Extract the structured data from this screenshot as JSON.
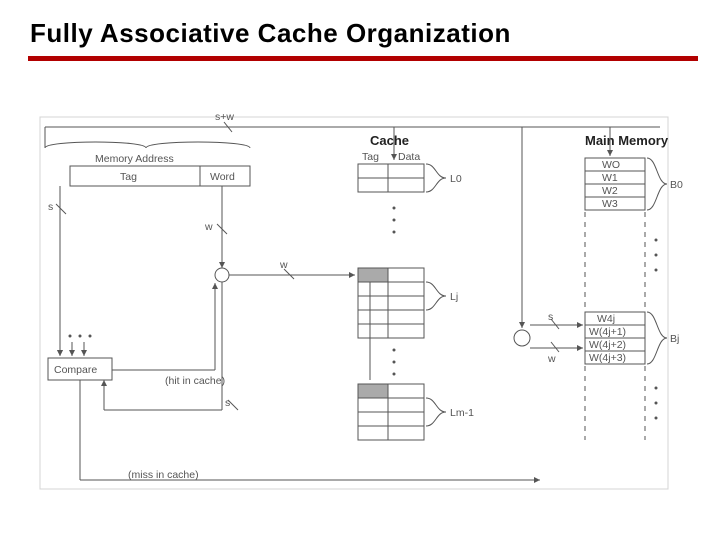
{
  "title": "Fully Associative Cache Organization",
  "labels": {
    "s_plus_w": "s+w",
    "mem_addr": "Memory Address",
    "tag": "Tag",
    "word": "Word",
    "s": "s",
    "w": "w",
    "compare": "Compare",
    "hit": "(hit in cache)",
    "miss": "(miss in cache)",
    "cache": "Cache",
    "cache_tag": "Tag",
    "cache_data": "Data",
    "L0": "L0",
    "Lj": "Lj",
    "Lm1": "Lm-1",
    "main_memory": "Main Memory",
    "WO": "WO",
    "W1": "W1",
    "W2": "W2",
    "W3": "W3",
    "B0": "B0",
    "W4j": "W4j",
    "W4j1": "W(4j+1)",
    "W4j2": "W(4j+2)",
    "W4j3": "W(4j+3)",
    "Bj": "Bj"
  },
  "chart_data": {
    "type": "table",
    "title": "Fully Associative Cache Organization",
    "components": [
      {
        "name": "Memory Address",
        "fields": [
          "Tag (s bits)",
          "Word (w bits)"
        ],
        "total_width": "s+w"
      },
      {
        "name": "Cache",
        "columns": [
          "Tag",
          "Data"
        ],
        "lines": [
          "L0",
          "...",
          "Lj",
          "...",
          "Lm-1"
        ]
      },
      {
        "name": "Main Memory",
        "blocks": [
          {
            "id": "B0",
            "words": [
              "WO",
              "W1",
              "W2",
              "W3"
            ]
          },
          {
            "id": "Bj",
            "words": [
              "W4j",
              "W(4j+1)",
              "W(4j+2)",
              "W(4j+3)"
            ]
          }
        ]
      },
      {
        "name": "Compare",
        "inputs": [
          "Tag (s bits) from address",
          "Tag from cache lines"
        ],
        "outputs": [
          "hit in cache",
          "miss in cache"
        ]
      }
    ],
    "connections": [
      "s+w bus from address to Cache and Main Memory",
      "s bits from Tag to Compare",
      "w bits from Cache Tag to compare/select (width label w)",
      "s bits from cache tag entry back to Compare",
      "hit in cache signal from Compare",
      "miss in cache signal from Compare",
      "s and w signals at Main Memory decode circle"
    ]
  }
}
